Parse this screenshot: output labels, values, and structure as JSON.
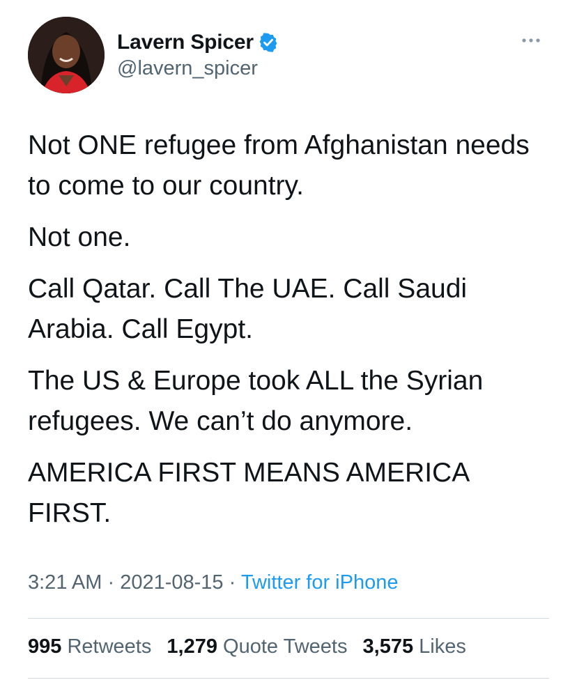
{
  "author": {
    "display_name": "Lavern Spicer",
    "handle": "@lavern_spicer",
    "verified_icon": "verified-badge-icon",
    "avatar_icon": "avatar"
  },
  "more_icon": "more-options-icon",
  "tweet": {
    "paragraphs": [
      "Not ONE refugee from Afghanistan needs to come to our country.",
      "Not one.",
      "Call Qatar. Call The UAE. Call Saudi Arabia. Call Egypt.",
      "The US & Europe took ALL the Syrian refugees. We can’t do anymore.",
      "AMERICA FIRST MEANS AMERICA FIRST."
    ]
  },
  "meta": {
    "time": "3:21 AM",
    "separator": "·",
    "date": "2021-08-15",
    "source": "Twitter for iPhone"
  },
  "stats": {
    "retweets_count": "995",
    "retweets_label": "Retweets",
    "quotes_count": "1,279",
    "quotes_label": "Quote Tweets",
    "likes_count": "3,575",
    "likes_label": "Likes"
  },
  "colors": {
    "text": "#0f1419",
    "secondary": "#536471",
    "link": "#1d9bf0",
    "divider": "#cfd9de"
  }
}
